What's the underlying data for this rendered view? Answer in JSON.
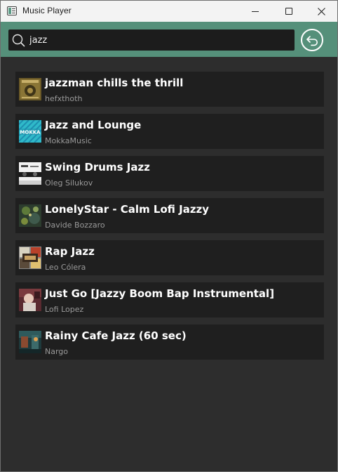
{
  "window": {
    "title": "Music Player"
  },
  "search": {
    "value": "jazz",
    "placeholder": ""
  },
  "colors": {
    "accent": "#55907a",
    "background": "#2d2d2d",
    "item_background": "#1f1f1f",
    "artist_text": "#9a9a9a"
  },
  "results": [
    {
      "title": "jazzman chills the thrill",
      "artist": "hefxthoth"
    },
    {
      "title": "Jazz and Lounge",
      "artist": "MokkaMusic",
      "thumb_text": "MOKKA"
    },
    {
      "title": "Swing Drums Jazz",
      "artist": "Oleg Silukov"
    },
    {
      "title": "LonelyStar - Calm Lofi Jazzy",
      "artist": "Davide Bozzaro"
    },
    {
      "title": "Rap Jazz",
      "artist": "Leo Cólera"
    },
    {
      "title": "Just Go [Jazzy Boom Bap Instrumental]",
      "artist": "Lofi Lopez"
    },
    {
      "title": "Rainy Cafe Jazz (60 sec)",
      "artist": "Nargo"
    }
  ]
}
